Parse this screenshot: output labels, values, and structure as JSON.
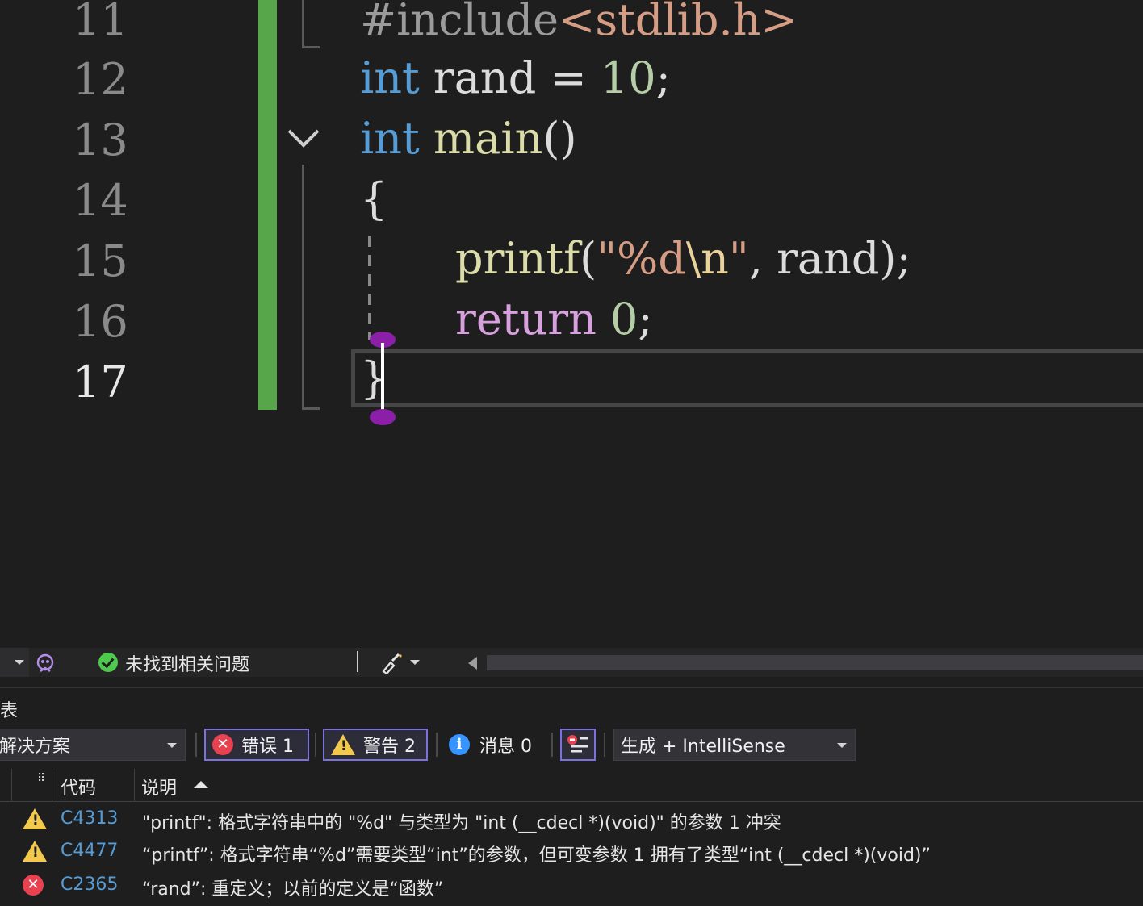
{
  "editor": {
    "line_numbers": [
      "11",
      "12",
      "13",
      "14",
      "15",
      "16",
      "17"
    ],
    "lines": {
      "l11": {
        "directive": "#include",
        "header": "<stdlib.h>"
      },
      "l12": {
        "kw": "int",
        "ident": " rand ",
        "op": "= ",
        "num": "10",
        "semi": ";"
      },
      "l13": {
        "kw": "int",
        "fn": " main",
        "paren": "()"
      },
      "l14": {
        "brace": "{"
      },
      "l15": {
        "fn": "printf",
        "open": "(",
        "str1": "\"%d",
        "esc": "\\n",
        "str2": "\"",
        "rest": ", rand);"
      },
      "l16": {
        "kw": "return",
        "num": " 0",
        "semi": ";"
      },
      "l17": {
        "brace": "}"
      }
    }
  },
  "editor_status": {
    "message": "未找到相关问题"
  },
  "error_list": {
    "title": "表",
    "scope_label": "解决方案",
    "errors_label": "错误 1",
    "warnings_label": "警告 2",
    "messages_label": "消息 0",
    "build_filter": "生成 + IntelliSense",
    "columns": {
      "code": "代码",
      "description": "说明"
    },
    "rows": [
      {
        "severity": "warning",
        "code": "C4313",
        "description": "\"printf\": 格式字符串中的 \"%d\" 与类型为 \"int (__cdecl *)(void)\" 的参数 1 冲突"
      },
      {
        "severity": "warning",
        "code": "C4477",
        "description": "“printf”: 格式字符串“%d”需要类型“int”的参数，但可变参数 1 拥有了类型“int (__cdecl *)(void)”"
      },
      {
        "severity": "error",
        "code": "C2365",
        "description": "“rand”: 重定义；以前的定义是“函数”"
      }
    ]
  },
  "colors": {
    "keyword": "#569cd6",
    "function": "#dcdcaa",
    "string": "#d69d85",
    "number": "#b5cea8",
    "control": "#d8a0df",
    "change_bar": "#57a64a",
    "accent_border": "#7b73d9"
  },
  "icons": [
    "chevron-down-icon",
    "check-circle-icon",
    "error-icon",
    "warning-icon",
    "info-icon",
    "filter-icon",
    "brush-icon",
    "copilot-icon"
  ]
}
